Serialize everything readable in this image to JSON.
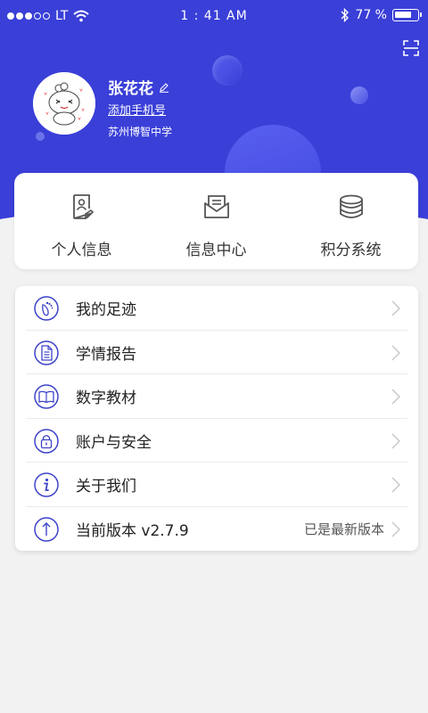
{
  "status_bar": {
    "carrier": "LT",
    "time": "1 : 41 AM",
    "battery_percent": "77 %",
    "battery_level": 0.77
  },
  "profile": {
    "name": "张花花",
    "add_phone_link": "添加手机号",
    "school": "苏州博智中学"
  },
  "quick_actions": [
    {
      "label": "个人信息",
      "icon": "personal-info-icon"
    },
    {
      "label": "信息中心",
      "icon": "message-center-icon"
    },
    {
      "label": "积分系统",
      "icon": "points-icon"
    }
  ],
  "menu": [
    {
      "label": "我的足迹",
      "icon": "footprint-icon",
      "right": ""
    },
    {
      "label": "学情报告",
      "icon": "report-icon",
      "right": ""
    },
    {
      "label": "数字教材",
      "icon": "book-icon",
      "right": ""
    },
    {
      "label": "账户与安全",
      "icon": "lock-icon",
      "right": ""
    },
    {
      "label": "关于我们",
      "icon": "info-icon",
      "right": ""
    },
    {
      "label": "当前版本 v2.7.9",
      "icon": "upgrade-icon",
      "right": "已是最新版本"
    }
  ],
  "colors": {
    "brand": "#3a3fd8",
    "icon": "#3d43c9",
    "background": "#f2f2f2"
  }
}
